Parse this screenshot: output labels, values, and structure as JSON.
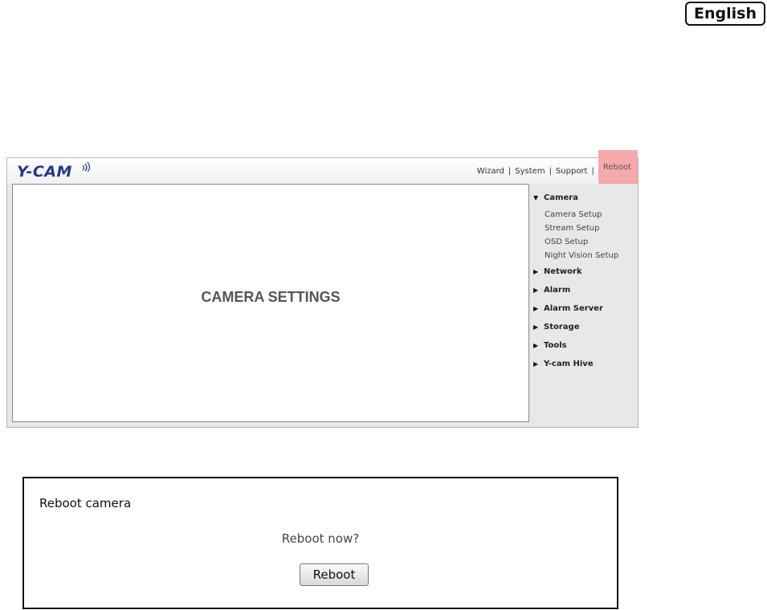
{
  "language": {
    "label": "English"
  },
  "app": {
    "logo_text": "Y-CAM",
    "top_nav": {
      "wizard": "Wizard",
      "system": "System",
      "support": "Support",
      "reboot": "Reboot",
      "separator": "|"
    },
    "main_title": "CAMERA SETTINGS",
    "sidebar": {
      "camera": {
        "label": "Camera",
        "expanded": true,
        "items": [
          "Camera Setup",
          "Stream Setup",
          "OSD Setup",
          "Night Vision Setup"
        ]
      },
      "network": {
        "label": "Network"
      },
      "alarm": {
        "label": "Alarm"
      },
      "alarm_server": {
        "label": "Alarm Server"
      },
      "storage": {
        "label": "Storage"
      },
      "tools": {
        "label": "Tools"
      },
      "hive": {
        "label": "Y-cam Hive"
      }
    },
    "highlight_color": "#f6a8ab"
  },
  "reboot_dialog": {
    "title": "Reboot camera",
    "question": "Reboot now?",
    "button": "Reboot"
  }
}
